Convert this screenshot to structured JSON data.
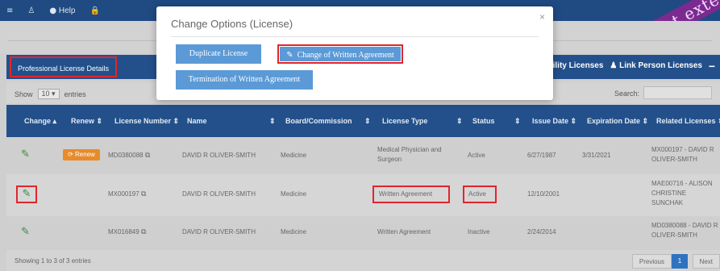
{
  "topbar": {
    "menu_icon": "≡",
    "user_icon": "♙",
    "help_label": "Help",
    "lock_icon": "🔒"
  },
  "banner_text": "st exte",
  "section": {
    "title": "Professional License Details",
    "facility_link": "cility Licenses",
    "link_person": "Link Person Licenses",
    "collapse_icon": "−"
  },
  "controls": {
    "show_label": "Show",
    "entries_value": "10",
    "entries_label": "entries",
    "search_label": "Search:"
  },
  "table": {
    "headers": {
      "change": "Change",
      "renew": "Renew",
      "license_number": "License Number",
      "name": "Name",
      "board": "Board/Commission",
      "license_type": "License Type",
      "status": "Status",
      "issue_date": "Issue Date",
      "expiration_date": "Expiration Date",
      "related": "Related Licenses"
    },
    "rows": [
      {
        "renew": "Renew",
        "license_number": "MD0380088",
        "name": "DAVID R OLIVER-SMITH",
        "board": "Medicine",
        "license_type": "Medical Physician and Surgeon",
        "status": "Active",
        "issue_date": "6/27/1987",
        "expiration_date": "3/31/2021",
        "related": "MX000197 - DAVID R OLIVER-SMITH"
      },
      {
        "renew": "",
        "license_number": "MX000197",
        "name": "DAVID R OLIVER-SMITH",
        "board": "Medicine",
        "license_type": "Written Agreement",
        "status": "Active",
        "issue_date": "12/10/2001",
        "expiration_date": "",
        "related": "MAE00716 - ALISON CHRISTINE SUNCHAK"
      },
      {
        "renew": "",
        "license_number": "MX016849",
        "name": "DAVID R OLIVER-SMITH",
        "board": "Medicine",
        "license_type": "Written Agreement",
        "status": "Inactive",
        "issue_date": "2/24/2014",
        "expiration_date": "",
        "related": "MD0380088 - DAVID R OLIVER-SMITH"
      }
    ]
  },
  "footer": {
    "info": "Showing 1 to 3 of 3 entries",
    "previous": "Previous",
    "page": "1",
    "next": "Next"
  },
  "modal": {
    "title": "Change Options (License)",
    "close": "×",
    "duplicate": "Duplicate License",
    "change_written": "Change of Written Agreement",
    "termination": "Termination of Written Agreement"
  },
  "colors": {
    "header_blue": "#23508a",
    "button_blue": "#5b9ad6",
    "highlight_red": "#e0262b",
    "renew_orange": "#e88b2a",
    "banner_purple": "#7b2a8f"
  }
}
